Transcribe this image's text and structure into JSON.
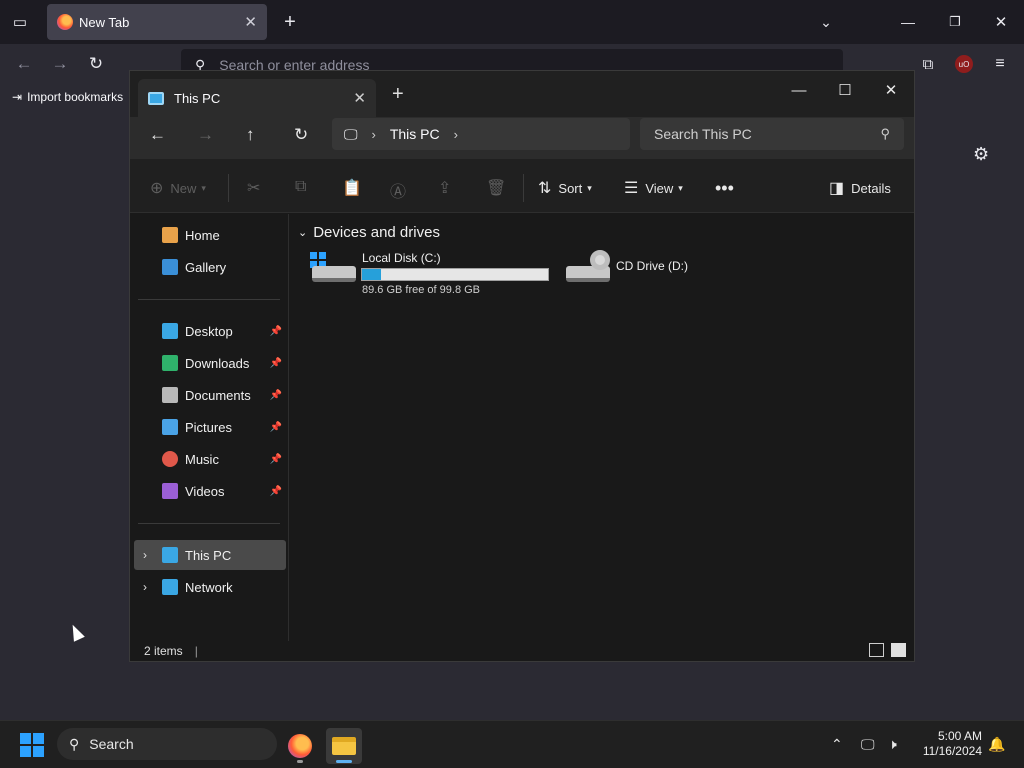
{
  "browser": {
    "tab_title": "New Tab",
    "address_placeholder": "Search or enter address",
    "import_bookmarks": "Import bookmarks"
  },
  "explorer": {
    "tab_title": "This PC",
    "breadcrumb": [
      "This PC"
    ],
    "search_placeholder": "Search This PC",
    "toolbar": {
      "new": "New",
      "sort": "Sort",
      "view": "View",
      "details": "Details"
    },
    "sidebar": {
      "quick": [
        {
          "label": "Home",
          "color": "#e8a24a"
        },
        {
          "label": "Gallery",
          "color": "#3a8fd8"
        }
      ],
      "pinned": [
        {
          "label": "Desktop",
          "color": "#3aa7e4"
        },
        {
          "label": "Downloads",
          "color": "#2fb26b"
        },
        {
          "label": "Documents",
          "color": "#b8b8b8"
        },
        {
          "label": "Pictures",
          "color": "#4aa3e6"
        },
        {
          "label": "Music",
          "color": "#e0584a"
        },
        {
          "label": "Videos",
          "color": "#9b5fd6"
        }
      ],
      "tree": [
        {
          "label": "This PC",
          "color": "#3aa7e4",
          "selected": true
        },
        {
          "label": "Network",
          "color": "#3aa7e4",
          "selected": false
        }
      ]
    },
    "group_header": "Devices and drives",
    "drives": [
      {
        "name": "Local Disk (C:)",
        "free_text": "89.6 GB free of 99.8 GB",
        "used_fraction": 0.102
      },
      {
        "name": "CD Drive (D:)"
      }
    ],
    "status_items": "2 items"
  },
  "taskbar": {
    "search_label": "Search",
    "time": "5:00 AM",
    "date": "11/16/2024"
  }
}
